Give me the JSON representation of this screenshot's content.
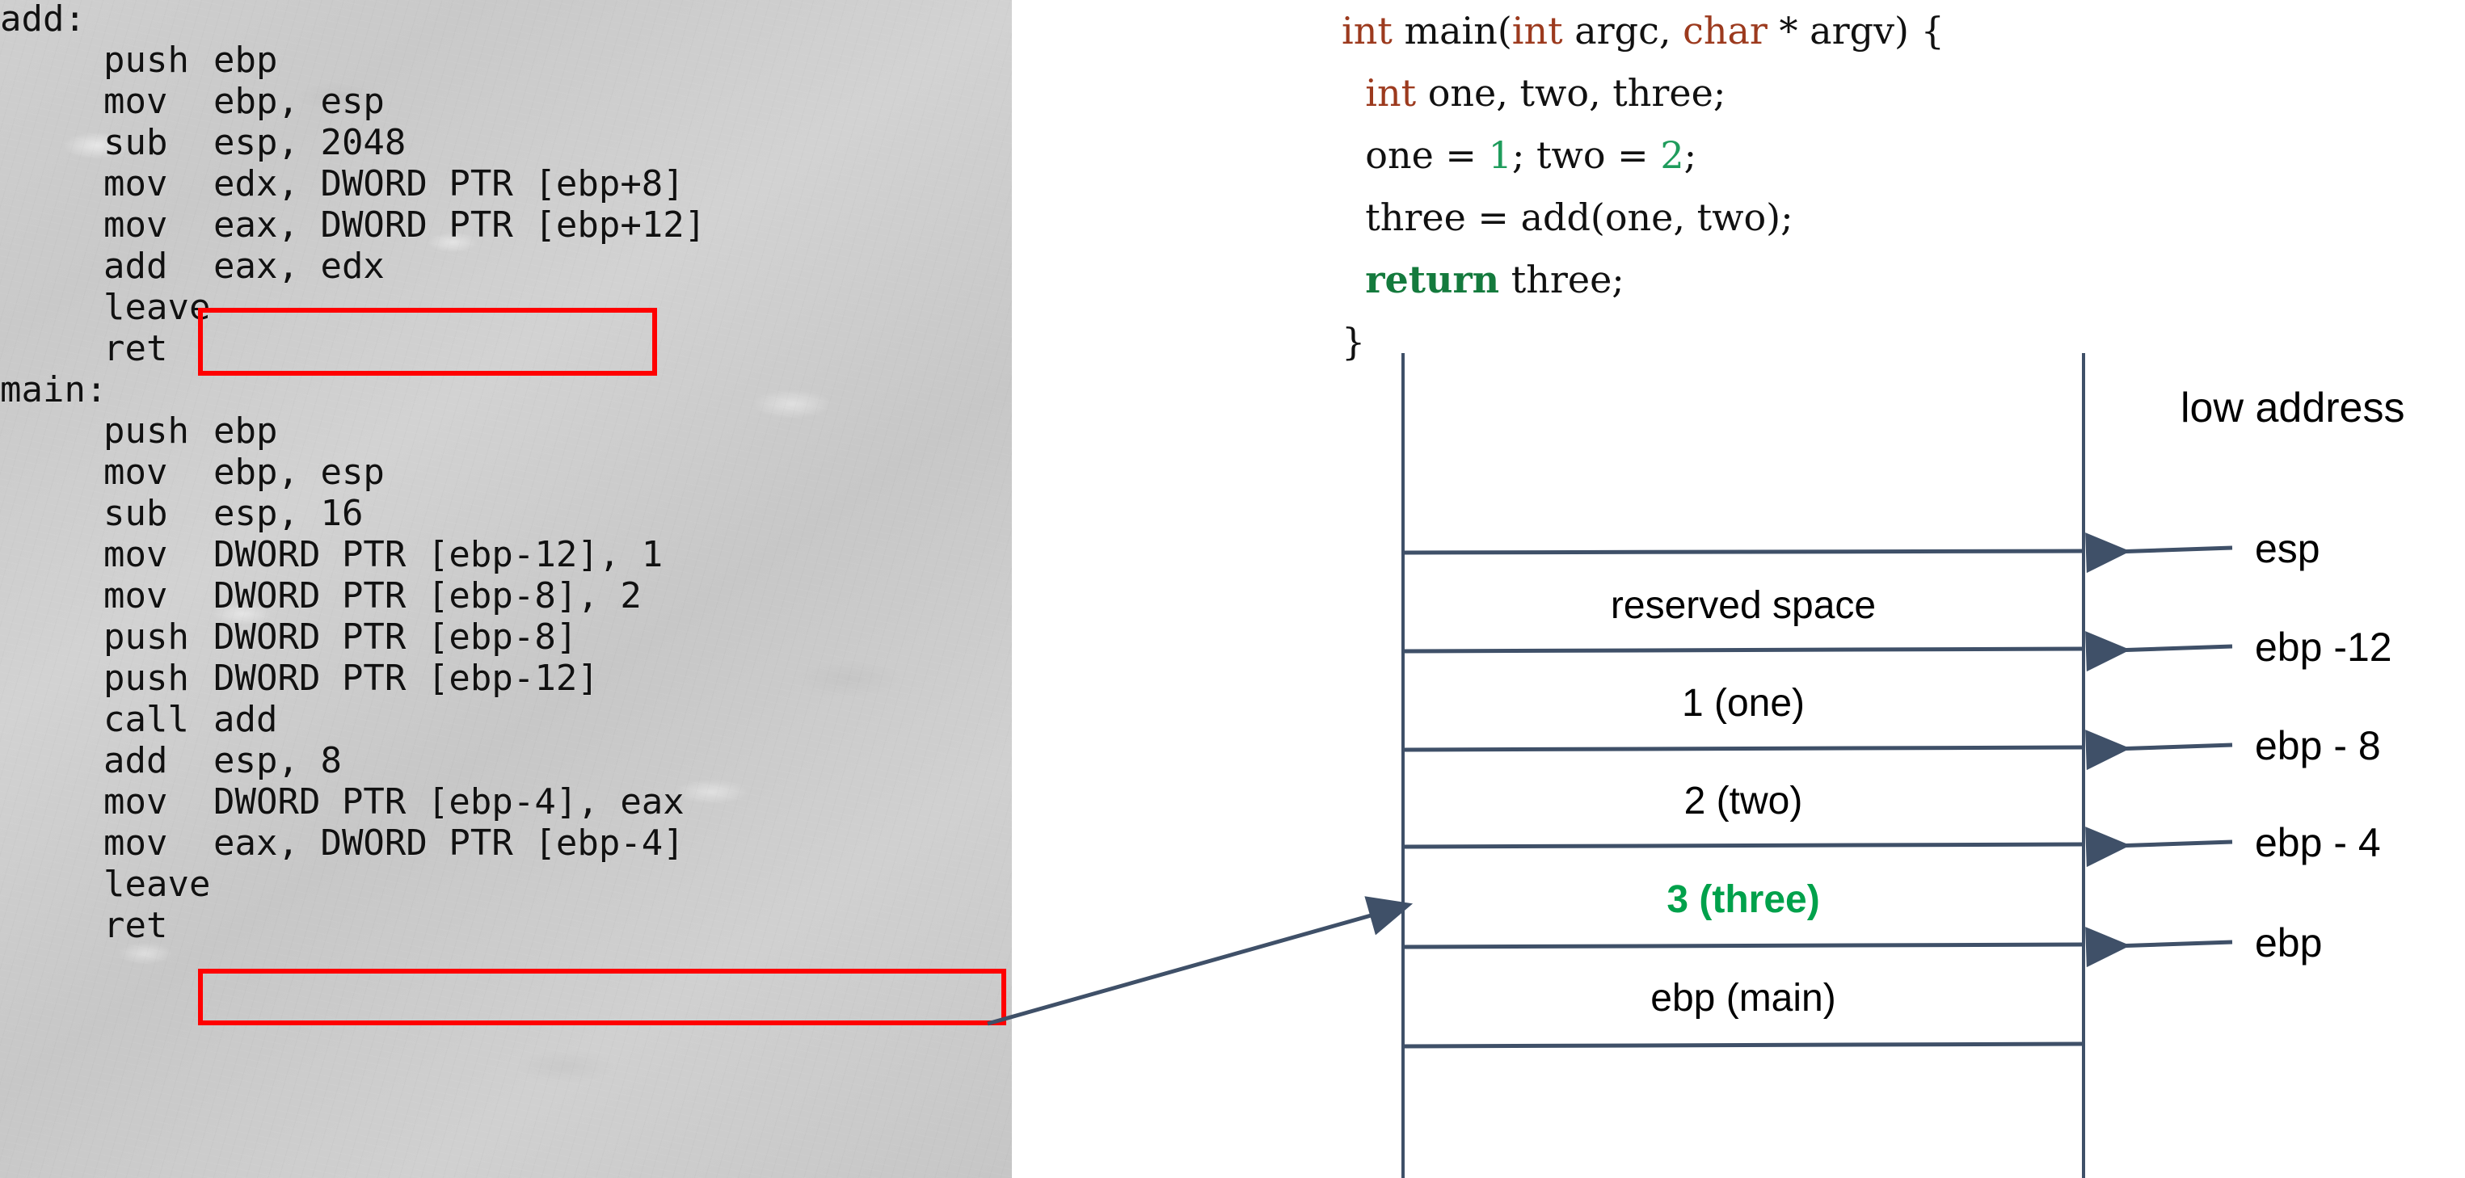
{
  "assembly": {
    "lines": [
      {
        "label": "add:",
        "instr": "",
        "op": ""
      },
      {
        "label": "",
        "instr": "push",
        "op": "ebp"
      },
      {
        "label": "",
        "instr": "mov",
        "op": "ebp, esp"
      },
      {
        "label": "",
        "instr": "sub",
        "op": "esp, 2048"
      },
      {
        "label": "",
        "instr": "mov",
        "op": "edx, DWORD PTR [ebp+8]"
      },
      {
        "label": "",
        "instr": "mov",
        "op": "eax, DWORD PTR [ebp+12]"
      },
      {
        "label": "",
        "instr": "add",
        "op": "eax, edx"
      },
      {
        "label": "",
        "instr": "leave",
        "op": ""
      },
      {
        "label": "",
        "instr": "ret",
        "op": ""
      },
      {
        "label": "main:",
        "instr": "",
        "op": ""
      },
      {
        "label": "",
        "instr": "push",
        "op": "ebp"
      },
      {
        "label": "",
        "instr": "mov",
        "op": "ebp, esp"
      },
      {
        "label": "",
        "instr": "sub",
        "op": "esp, 16"
      },
      {
        "label": "",
        "instr": "mov",
        "op": "DWORD PTR [ebp-12], 1"
      },
      {
        "label": "",
        "instr": "mov",
        "op": "DWORD PTR [ebp-8], 2"
      },
      {
        "label": "",
        "instr": "push",
        "op": "DWORD PTR [ebp-8]"
      },
      {
        "label": "",
        "instr": "push",
        "op": "DWORD PTR [ebp-12]"
      },
      {
        "label": "",
        "instr": "call",
        "op": "add"
      },
      {
        "label": "",
        "instr": "add",
        "op": "esp, 8"
      },
      {
        "label": "",
        "instr": "mov",
        "op": "DWORD PTR [ebp-4], eax"
      },
      {
        "label": "",
        "instr": "mov",
        "op": "eax, DWORD PTR [ebp-4]"
      },
      {
        "label": "",
        "instr": "leave",
        "op": ""
      },
      {
        "label": "",
        "instr": "ret",
        "op": ""
      }
    ],
    "highlight_color": "#ff0000",
    "highlighted_lines": [
      "add       eax, edx",
      "mov       DWORD PTR [ebp-4], eax"
    ]
  },
  "c_code": {
    "lines": [
      [
        {
          "t": "int",
          "c": "kw-type"
        },
        {
          "t": " main("
        },
        {
          "t": "int",
          "c": "kw-type"
        },
        {
          "t": " argc, "
        },
        {
          "t": "char",
          "c": "kw-type"
        },
        {
          "t": " * argv) {"
        }
      ],
      [
        {
          "t": "  "
        },
        {
          "t": "int",
          "c": "kw-type"
        },
        {
          "t": " one, two, three;"
        }
      ],
      [
        {
          "t": "  one = "
        },
        {
          "t": "1",
          "c": "num"
        },
        {
          "t": "; two = "
        },
        {
          "t": "2",
          "c": "num"
        },
        {
          "t": ";"
        }
      ],
      [
        {
          "t": "  three = add(one, two);"
        }
      ],
      [
        {
          "t": "  "
        },
        {
          "t": "return",
          "c": "kw-ret"
        },
        {
          "t": " three;"
        }
      ],
      [
        {
          "t": "}"
        }
      ]
    ],
    "colors": {
      "type_keyword": "#9c3a1e",
      "return_keyword": "#147a3d",
      "number": "#1f9c5c",
      "text": "#111111"
    }
  },
  "stack_diagram": {
    "title_low_address": "low address",
    "cells": [
      {
        "text": "reserved space",
        "color": "#000000"
      },
      {
        "text": "1 (one)",
        "color": "#000000"
      },
      {
        "text": "2 (two)",
        "color": "#000000"
      },
      {
        "text": "3 (three)",
        "color": "#00a14b"
      },
      {
        "text": "ebp (main)",
        "color": "#000000"
      }
    ],
    "pointers": [
      {
        "label": "esp"
      },
      {
        "label": "ebp -12"
      },
      {
        "label": "ebp - 8"
      },
      {
        "label": "ebp - 4"
      },
      {
        "label": "ebp"
      }
    ],
    "line_color": "#3f5068",
    "callout_arrow_from": "mov       DWORD PTR [ebp-4], eax",
    "callout_arrow_to": "3 (three)"
  }
}
